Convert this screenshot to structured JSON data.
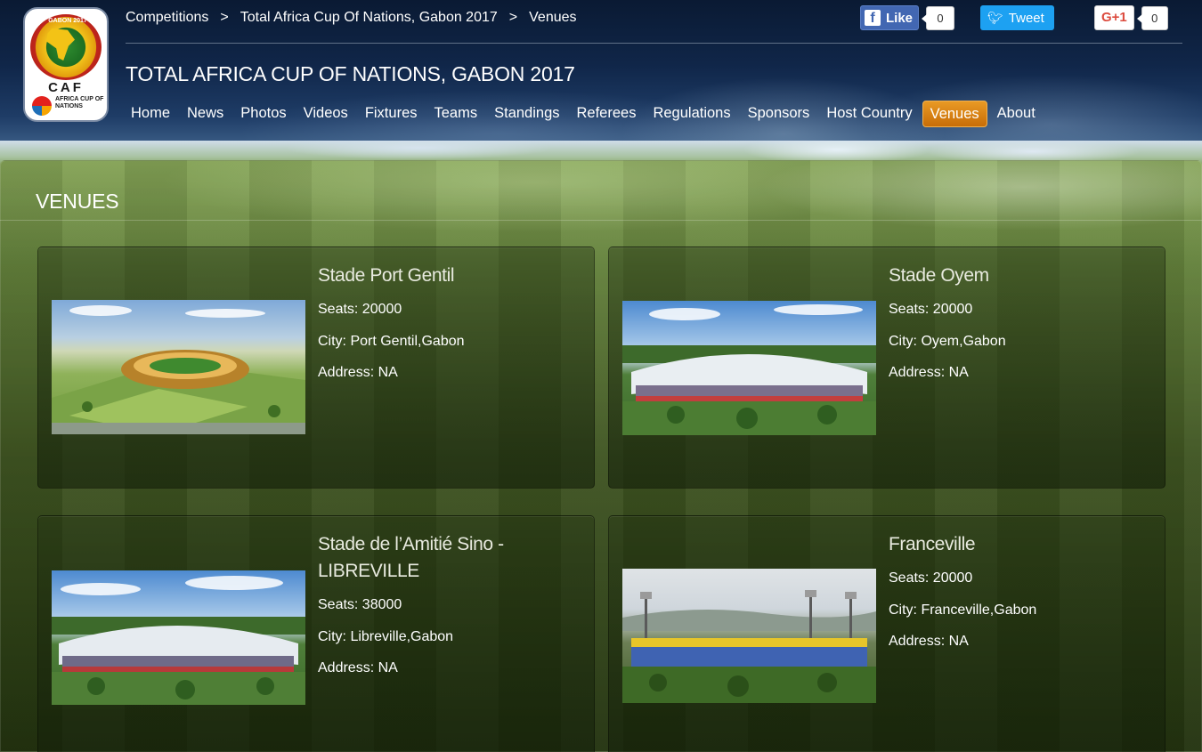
{
  "breadcrumb": {
    "items": [
      "Competitions",
      "Total Africa Cup Of Nations, Gabon 2017",
      "Venues"
    ],
    "separator": ">"
  },
  "logo": {
    "top_text": "GABON 2017",
    "brand": "CAF",
    "subtitle": "AFRICA CUP OF NATIONS"
  },
  "site_title": "TOTAL AFRICA CUP OF NATIONS, GABON 2017",
  "nav": {
    "items": [
      "Home",
      "News",
      "Photos",
      "Videos",
      "Fixtures",
      "Teams",
      "Standings",
      "Referees",
      "Regulations",
      "Sponsors",
      "Host Country",
      "Venues",
      "About"
    ],
    "active": "Venues"
  },
  "social": {
    "facebook": {
      "label": "Like",
      "count": "0"
    },
    "twitter": {
      "label": "Tweet"
    },
    "google": {
      "label": "G+1",
      "count": "0"
    }
  },
  "section_title": "VENUES",
  "venues": [
    {
      "name": "Stade Port Gentil",
      "seats": "Seats: 20000",
      "city": "City: Port Gentil,Gabon",
      "address": "Address: NA"
    },
    {
      "name": "Stade Oyem",
      "seats": "Seats: 20000",
      "city": "City: Oyem,Gabon",
      "address": "Address: NA"
    },
    {
      "name": "Stade de l’Amitié Sino - LIBREVILLE",
      "seats": "Seats: 38000",
      "city": "City: Libreville,Gabon",
      "address": "Address: NA"
    },
    {
      "name": "Franceville",
      "seats": "Seats: 20000",
      "city": "City: Franceville,Gabon",
      "address": "Address: NA"
    }
  ],
  "colors": {
    "nav_active": "#d47c12",
    "facebook": "#4267b2",
    "twitter": "#1da1f2",
    "google": "#dc4b3e"
  }
}
